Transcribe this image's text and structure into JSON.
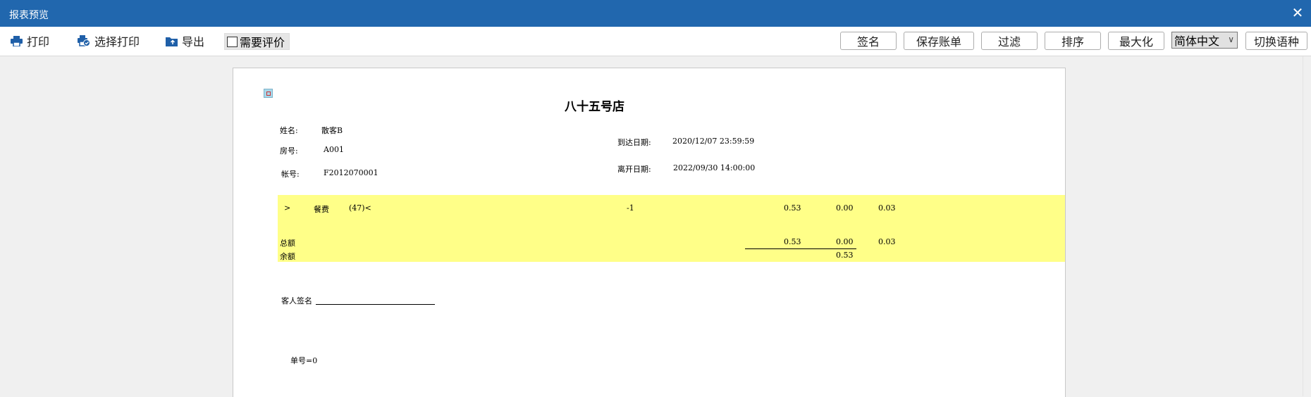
{
  "window": {
    "title": "报表预览",
    "close_glyph": "✕"
  },
  "toolbar": {
    "print_label": "打印",
    "select_print_label": "选择打印",
    "export_label": "导出",
    "need_review_label": "需要评价",
    "sign_label": "签名",
    "save_bill_label": "保存账单",
    "filter_label": "过滤",
    "sort_label": "排序",
    "maximize_label": "最大化",
    "language_selected": "简体中文",
    "switch_language_label": "切换语种"
  },
  "report": {
    "title": "八十五号店",
    "name_label": "姓名:",
    "name_value": "散客B",
    "room_label": "房号:",
    "room_value": "A001",
    "account_label": "帐号:",
    "account_value": "F2012070001",
    "arrival_label": "到达日期:",
    "arrival_value": "2020/12/07 23:59:59",
    "departure_label": "离开日期:",
    "departure_value": "2022/09/30 14:00:00",
    "item": {
      "expand": ">",
      "name": "餐费",
      "code": "(47)<",
      "qty": "-1",
      "amount": "0.53",
      "paid": "0.00",
      "other": "0.03"
    },
    "total": {
      "label": "总额",
      "amount": "0.53",
      "paid": "0.00",
      "other": "0.03"
    },
    "balance": {
      "label": "余额",
      "value": "0.53"
    },
    "signature_label": "客人签名",
    "bill_no": "单号=0"
  },
  "colors": {
    "titlebar": "#2167ae",
    "highlight": "#ffff88"
  }
}
